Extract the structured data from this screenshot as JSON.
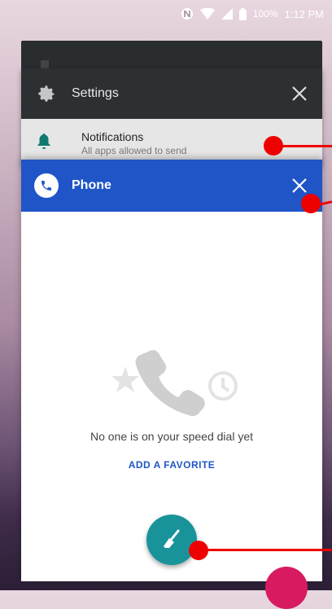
{
  "status_bar": {
    "battery_percent": "100%",
    "time": "1:12 PM",
    "icons": [
      "nfc-icon",
      "wifi-icon",
      "cell-signal-icon",
      "battery-icon"
    ]
  },
  "recents": {
    "settings_card": {
      "title": "Settings",
      "icon": "gear-icon",
      "notification_title": "Notifications",
      "notification_subtitle": "All apps allowed to send"
    },
    "phone_card": {
      "title": "Phone",
      "icon": "phone-icon",
      "empty_message": "No one is on your speed dial yet",
      "action_label": "ADD A FAVORITE"
    },
    "clear_all_icon": "broom-icon"
  },
  "colors": {
    "phone_header": "#1f55c7",
    "settings_header": "#2d3033",
    "fab": "#19939a",
    "annotation": "#ee0000"
  }
}
